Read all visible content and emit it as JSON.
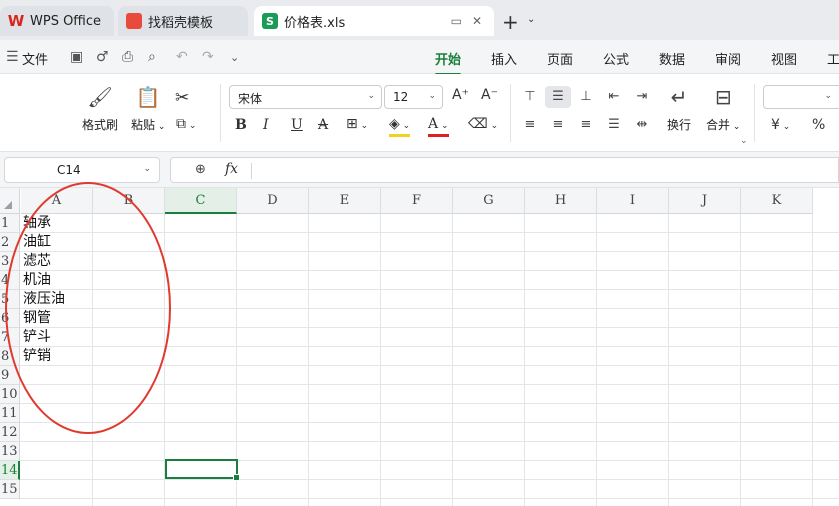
{
  "tabs": [
    {
      "label": "WPS Office",
      "icon": "wps-logo-icon"
    },
    {
      "label": "找稻壳模板",
      "icon": "docer-icon"
    },
    {
      "label": "价格表.xls",
      "icon": "spreadsheet-s-icon"
    }
  ],
  "menu": {
    "file_label": "文件",
    "items": [
      "开始",
      "插入",
      "页面",
      "公式",
      "数据",
      "审阅",
      "视图",
      "工"
    ],
    "active": "开始"
  },
  "ribbon": {
    "format_painter": "格式刷",
    "paste": "粘贴",
    "font_name": "宋体",
    "font_size": "12",
    "wrap": "换行",
    "merge": "合并",
    "currency": "¥",
    "percent": "%"
  },
  "formula_bar": {
    "name_box": "C14",
    "fx": "fx",
    "formula": ""
  },
  "sheet": {
    "columns": [
      "A",
      "B",
      "C",
      "D",
      "E",
      "F",
      "G",
      "H",
      "I",
      "J",
      "K"
    ],
    "selected_column": "C",
    "rows": [
      "1",
      "2",
      "3",
      "4",
      "5",
      "6",
      "7",
      "8",
      "9",
      "10",
      "11",
      "12",
      "13",
      "14",
      "15"
    ],
    "selected_row": "14",
    "column_a": [
      "轴承",
      "油缸",
      "滤芯",
      "机油",
      "液压油",
      "钢管",
      "铲斗",
      "铲销"
    ]
  },
  "colors": {
    "accent": "#1a7f3c",
    "annotation": "#e03a2f"
  }
}
